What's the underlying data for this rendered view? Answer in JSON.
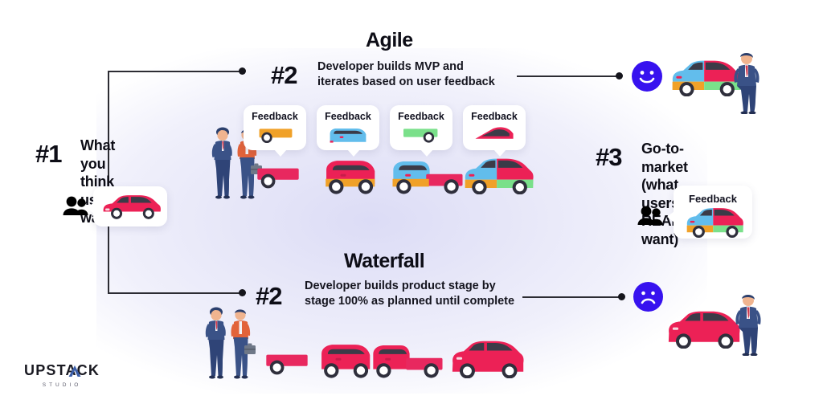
{
  "brand": {
    "name": "UPSTACK",
    "sub": "STUDIO",
    "accent_color": "#3b5ea8"
  },
  "canvas": {
    "background": "#ffffff",
    "glow_color": "#dcdcf6"
  },
  "palette": {
    "ink": "#0d0d16",
    "line": "#2c2c33",
    "happy_face": "#3712ef",
    "sad_face": "#3712ef",
    "red": "#ec2156",
    "pink": "#e8285f",
    "orange": "#f0a128",
    "blue": "#62bdec",
    "green": "#7ae08a",
    "suit_navy": "#2d4272",
    "worker_orange": "#e2633a",
    "bubble_white": "#ffffff"
  },
  "step1": {
    "number": "#1",
    "heading": "What you think\nusers want",
    "people_icon": "people-icon",
    "bubble": {
      "car": "red-hatchback"
    }
  },
  "agile": {
    "title": "Agile",
    "number": "#2",
    "description": "Developer builds MVP and\niterates based on user feedback",
    "builders_icon": "two-builders",
    "feedback_label": "Feedback",
    "stages": [
      {
        "feedback_label": "Feedback",
        "feedback_part": "orange-cart",
        "product": "pink-skateboard"
      },
      {
        "feedback_label": "Feedback",
        "feedback_part": "blue-cabin",
        "product": "pink-orange-compact"
      },
      {
        "feedback_label": "Feedback",
        "feedback_part": "green-flatbed",
        "product": "blue-pink-orange-truck"
      },
      {
        "feedback_label": "Feedback",
        "feedback_part": "pink-roof",
        "product": "four-color-hatchback"
      }
    ],
    "outcome": {
      "face": "happy-face",
      "car": "four-color-hatchback",
      "person": "businessman"
    }
  },
  "waterfall": {
    "title": "Waterfall",
    "number": "#2",
    "description": "Developer builds product stage by\nstage 100% as planned until complete",
    "builders_icon": "two-builders",
    "stages": [
      {
        "product": "red-skateboard"
      },
      {
        "product": "red-compact"
      },
      {
        "product": "red-truck"
      },
      {
        "product": "red-hatchback"
      }
    ],
    "outcome": {
      "face": "sad-face",
      "car": "red-hatchback",
      "person": "businessman"
    }
  },
  "step3": {
    "number": "#3",
    "heading": "Go-to-market\n(what users REALLY want)",
    "people_icon": "people-icon",
    "bubble": {
      "label": "Feedback",
      "car": "four-color-hatchback"
    }
  }
}
